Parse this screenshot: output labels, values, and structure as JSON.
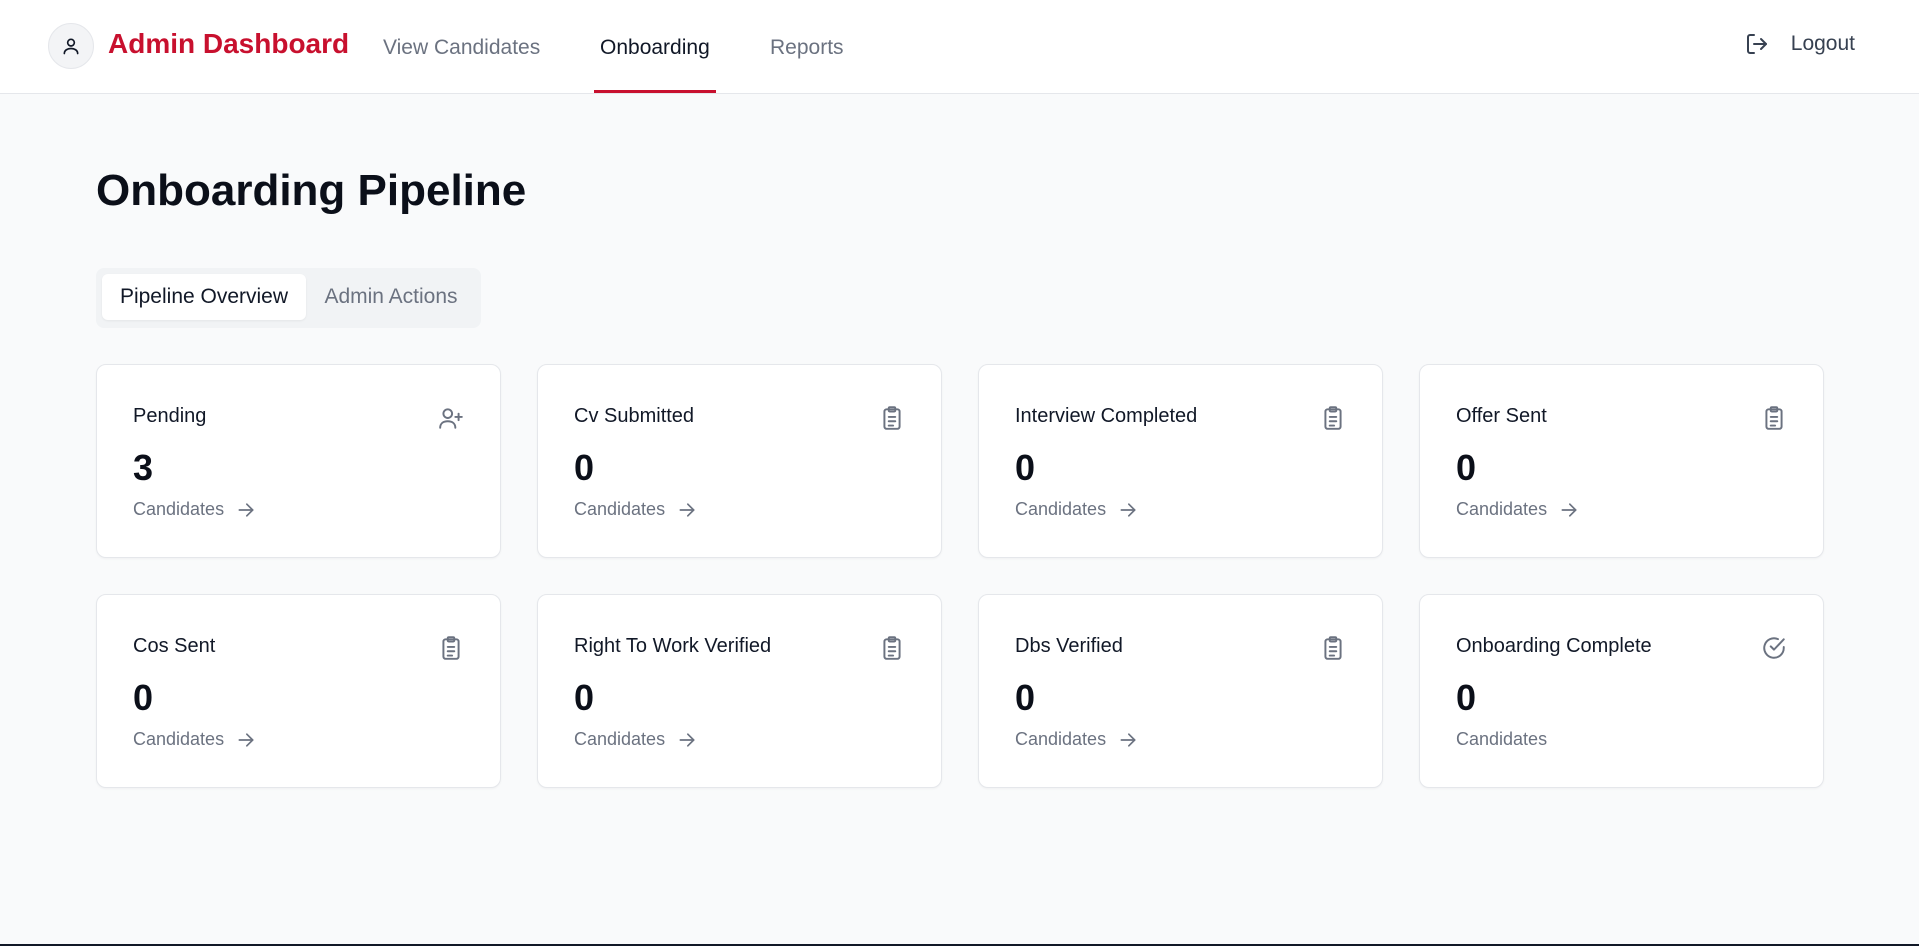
{
  "header": {
    "brand": "Admin Dashboard",
    "nav": [
      {
        "label": "View Candidates",
        "active": false
      },
      {
        "label": "Onboarding",
        "active": true
      },
      {
        "label": "Reports",
        "active": false
      }
    ],
    "logout_label": "Logout"
  },
  "main": {
    "title": "Onboarding Pipeline",
    "tabs": [
      {
        "label": "Pipeline Overview",
        "active": true
      },
      {
        "label": "Admin Actions",
        "active": false
      }
    ],
    "cards": [
      {
        "title": "Pending",
        "count": "3",
        "sub": "Candidates",
        "icon": "user-plus-icon"
      },
      {
        "title": "Cv Submitted",
        "count": "0",
        "sub": "Candidates",
        "icon": "clipboard-icon"
      },
      {
        "title": "Interview Completed",
        "count": "0",
        "sub": "Candidates",
        "icon": "clipboard-icon"
      },
      {
        "title": "Offer Sent",
        "count": "0",
        "sub": "Candidates",
        "icon": "clipboard-icon"
      },
      {
        "title": "Cos Sent",
        "count": "0",
        "sub": "Candidates",
        "icon": "clipboard-icon"
      },
      {
        "title": "Right To Work Verified",
        "count": "0",
        "sub": "Candidates",
        "icon": "clipboard-icon"
      },
      {
        "title": "Dbs Verified",
        "count": "0",
        "sub": "Candidates",
        "icon": "clipboard-icon"
      },
      {
        "title": "Onboarding Complete",
        "count": "0",
        "sub": "Candidates",
        "icon": "check-circle-icon"
      }
    ]
  },
  "colors": {
    "brand": "#c8102e",
    "background": "#f9fafb",
    "muted_text": "#6b7280"
  }
}
